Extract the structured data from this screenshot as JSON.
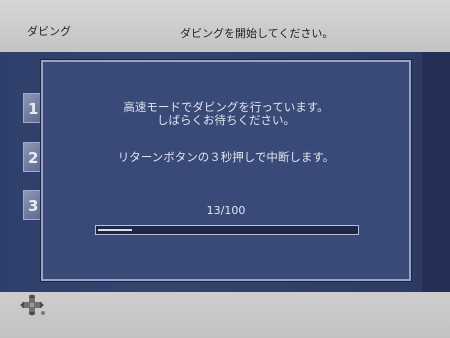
{
  "header": {
    "title": "ダビング",
    "message": "ダビングを開始してください。"
  },
  "steps": [
    "1",
    "2",
    "3"
  ],
  "dialog": {
    "line1": "高速モードでダビングを行っています。",
    "line2": "しばらくお待ちください。",
    "line3": "リターンボタンの３秒押しで中断します。",
    "progress_text": "13/100",
    "progress_fraction": 0.13
  },
  "footer": {
    "icon": "dpad-icon"
  }
}
